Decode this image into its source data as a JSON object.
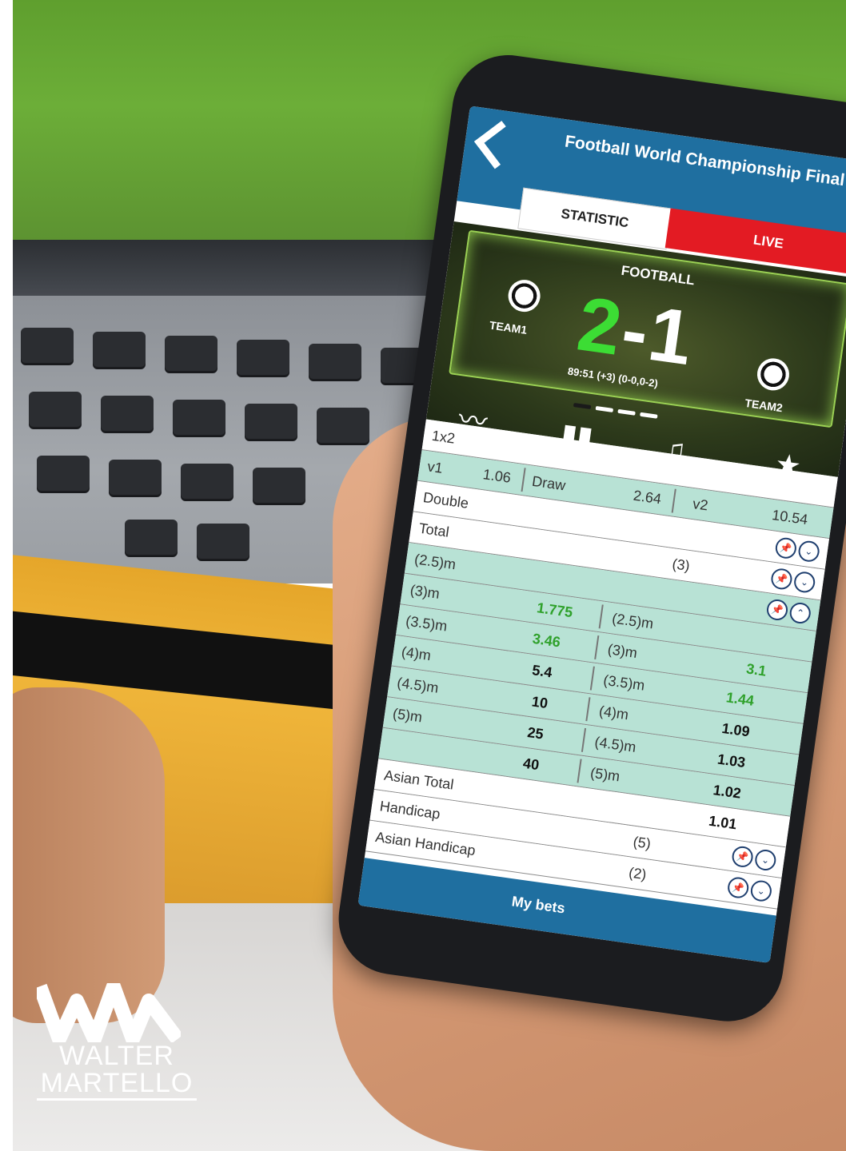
{
  "app": {
    "title": "Football World Championship Final",
    "tabs": [
      "STATISTIC",
      "LIVE"
    ]
  },
  "match": {
    "sport": "FOOTBALL",
    "home_team": "TEAM1",
    "away_team": "TEAM2",
    "home_score": "2",
    "away_score": "1",
    "separator": "-",
    "time": "89:51 (+3) (0-0,0-2)"
  },
  "nav_icons": [
    "line-chart-icon",
    "bar-chart-icon",
    "bell-icon",
    "star-icon"
  ],
  "markets": {
    "onex2": {
      "label": "1x2",
      "v1_label": "v1",
      "v1_odd": "1.06",
      "draw_label": "Draw",
      "draw_odd": "2.64",
      "v2_label": "v2",
      "v2_odd": "10.54"
    },
    "double": {
      "label": "Double"
    },
    "total": {
      "label": "Total",
      "count": "(3)"
    },
    "total_lines": [
      {
        "left_label": "(2.5)m",
        "left_odd": "",
        "right_label": "",
        "right_odd": ""
      },
      {
        "left_label": "(3)m",
        "left_odd": "1.775",
        "right_label": "(2.5)m",
        "right_odd": ""
      },
      {
        "left_label": "(3.5)m",
        "left_odd": "3.46",
        "right_label": "(3)m",
        "right_odd": "3.1"
      },
      {
        "left_label": "(4)m",
        "left_odd": "5.4",
        "right_label": "(3.5)m",
        "right_odd": "1.44"
      },
      {
        "left_label": "(4.5)m",
        "left_odd": "10",
        "right_label": "(4)m",
        "right_odd": "1.09"
      },
      {
        "left_label": "(5)m",
        "left_odd": "25",
        "right_label": "(4.5)m",
        "right_odd": "1.03"
      },
      {
        "left_label": "",
        "left_odd": "40",
        "right_label": "(5)m",
        "right_odd": "1.02"
      }
    ],
    "extra_odd": "1.01",
    "asian_total": {
      "label": "Asian Total"
    },
    "handicap": {
      "label": "Handicap",
      "count": "(5)"
    },
    "asian_handicap": {
      "label": "Asian Handicap",
      "count": "(2)"
    }
  },
  "footer": {
    "my_bets": "My bets"
  },
  "logo": {
    "line1": "WALTER",
    "line2": "MARTELLO"
  },
  "colors": {
    "topbar": "#1f6fa0",
    "live": "#e31b23",
    "score_green": "#3cdd34",
    "teal_row": "#b8e2d5"
  }
}
